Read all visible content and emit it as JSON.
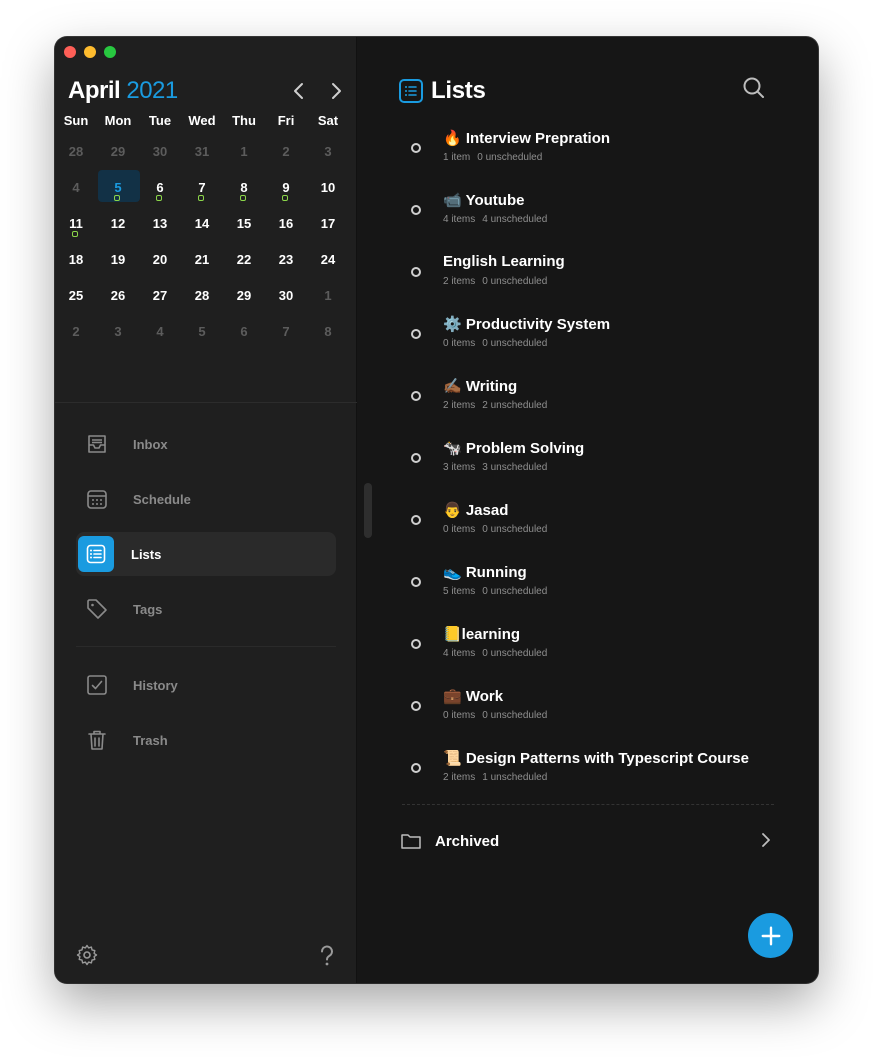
{
  "calendar": {
    "month": "April",
    "year": "2021",
    "weekdays": [
      "Sun",
      "Mon",
      "Tue",
      "Wed",
      "Thu",
      "Fri",
      "Sat"
    ],
    "weeks": [
      [
        {
          "d": "28",
          "m": true
        },
        {
          "d": "29",
          "m": true
        },
        {
          "d": "30",
          "m": true
        },
        {
          "d": "31",
          "m": true
        },
        {
          "d": "1",
          "m": true
        },
        {
          "d": "2",
          "m": true
        },
        {
          "d": "3",
          "m": true
        }
      ],
      [
        {
          "d": "4",
          "m": true
        },
        {
          "d": "5",
          "today": true,
          "dot": true
        },
        {
          "d": "6",
          "dot": true
        },
        {
          "d": "7",
          "dot": true
        },
        {
          "d": "8",
          "dot": true
        },
        {
          "d": "9",
          "dot": true
        },
        {
          "d": "10"
        }
      ],
      [
        {
          "d": "11",
          "dot": true
        },
        {
          "d": "12"
        },
        {
          "d": "13"
        },
        {
          "d": "14"
        },
        {
          "d": "15"
        },
        {
          "d": "16"
        },
        {
          "d": "17"
        }
      ],
      [
        {
          "d": "18"
        },
        {
          "d": "19"
        },
        {
          "d": "20"
        },
        {
          "d": "21"
        },
        {
          "d": "22"
        },
        {
          "d": "23"
        },
        {
          "d": "24"
        }
      ],
      [
        {
          "d": "25"
        },
        {
          "d": "26"
        },
        {
          "d": "27"
        },
        {
          "d": "28"
        },
        {
          "d": "29"
        },
        {
          "d": "30"
        },
        {
          "d": "1",
          "m": true
        }
      ],
      [
        {
          "d": "2",
          "m": true
        },
        {
          "d": "3",
          "m": true
        },
        {
          "d": "4",
          "m": true
        },
        {
          "d": "5",
          "m": true
        },
        {
          "d": "6",
          "m": true
        },
        {
          "d": "7",
          "m": true
        },
        {
          "d": "8",
          "m": true
        }
      ]
    ]
  },
  "sidebar": {
    "items": [
      {
        "label": "Inbox",
        "icon": "inbox-icon"
      },
      {
        "label": "Schedule",
        "icon": "calendar-icon"
      },
      {
        "label": "Lists",
        "icon": "list-icon",
        "active": true
      },
      {
        "label": "Tags",
        "icon": "tag-icon"
      },
      {
        "label": "History",
        "icon": "checkbox-icon"
      },
      {
        "label": "Trash",
        "icon": "trash-icon"
      }
    ]
  },
  "main": {
    "title": "Lists",
    "lists": [
      {
        "name": "🔥 Interview Prepration",
        "items": "1 item",
        "unscheduled": "0 unscheduled"
      },
      {
        "name": "📹 Youtube",
        "items": "4 items",
        "unscheduled": "4 unscheduled"
      },
      {
        "name": "English Learning",
        "items": "2 items",
        "unscheduled": "0 unscheduled"
      },
      {
        "name": "⚙️ Productivity System",
        "items": "0 items",
        "unscheduled": "0 unscheduled"
      },
      {
        "name": "✍🏾 Writing",
        "items": "2 items",
        "unscheduled": "2 unscheduled"
      },
      {
        "name": "🐄 Problem Solving",
        "items": "3 items",
        "unscheduled": "3 unscheduled"
      },
      {
        "name": "👨 Jasad",
        "items": "0 items",
        "unscheduled": "0 unscheduled"
      },
      {
        "name": "👟 Running",
        "items": "5 items",
        "unscheduled": "0 unscheduled"
      },
      {
        "name": "📒learning",
        "items": "4 items",
        "unscheduled": "0 unscheduled"
      },
      {
        "name": "💼 Work",
        "items": "0 items",
        "unscheduled": "0 unscheduled"
      },
      {
        "name": "📜 Design Patterns with Typescript Course",
        "items": "2 items",
        "unscheduled": "1 unscheduled"
      }
    ],
    "archived_label": "Archived"
  },
  "colors": {
    "accent": "#1a9be0",
    "dot": "#8bd64a",
    "background": "#161616",
    "sidebar": "#1f1f1f"
  }
}
